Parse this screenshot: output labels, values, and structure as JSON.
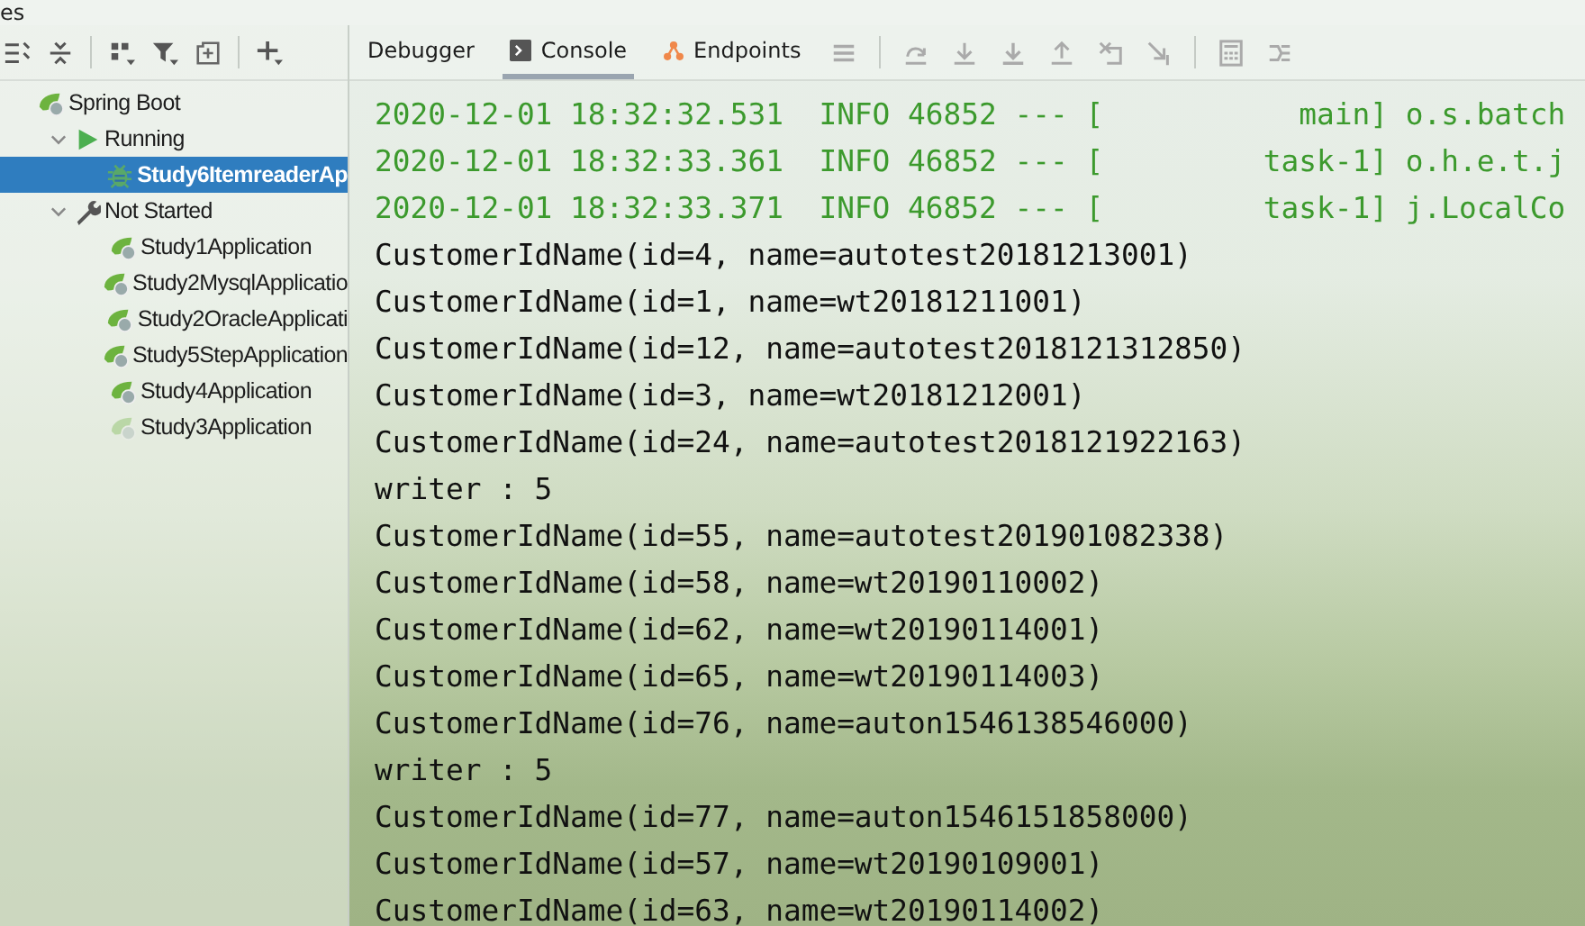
{
  "window": {
    "title": "es"
  },
  "tree": [
    {
      "label": "Spring Boot",
      "kind": "app",
      "selected": false,
      "children": [
        {
          "label": "Running",
          "kind": "run",
          "expanded": true,
          "selected": false,
          "children": [
            {
              "label": "Study6ItemreaderAp",
              "kind": "bug",
              "selected": true
            }
          ]
        },
        {
          "label": "Not Started",
          "kind": "wrench",
          "expanded": true,
          "selected": false,
          "children": [
            {
              "label": "Study1Application",
              "kind": "app",
              "selected": false
            },
            {
              "label": "Study2MysqlApplicatio",
              "kind": "app",
              "selected": false
            },
            {
              "label": "Study2OracleApplicati",
              "kind": "app",
              "selected": false
            },
            {
              "label": "Study5StepApplication",
              "kind": "app",
              "selected": false
            },
            {
              "label": "Study4Application",
              "kind": "app",
              "selected": false
            },
            {
              "label": "Study3Application",
              "kind": "idle",
              "selected": false
            }
          ]
        }
      ]
    }
  ],
  "tabs": [
    {
      "label": "Debugger",
      "kind": "plain",
      "selected": false
    },
    {
      "label": "Console",
      "kind": "console",
      "selected": true
    },
    {
      "label": "Endpoints",
      "kind": "endpoints",
      "selected": false
    }
  ],
  "console": [
    {
      "kind": "info",
      "text": "2020-12-01 18:32:32.531  INFO 46852 --- [           main] o.s.batch"
    },
    {
      "kind": "info",
      "text": "2020-12-01 18:32:33.361  INFO 46852 --- [         task-1] o.h.e.t.j"
    },
    {
      "kind": "info",
      "text": "2020-12-01 18:32:33.371  INFO 46852 --- [         task-1] j.LocalCo"
    },
    {
      "kind": "out",
      "text": "CustomerIdName(id=4, name=autotest20181213001)"
    },
    {
      "kind": "out",
      "text": "CustomerIdName(id=1, name=wt20181211001)"
    },
    {
      "kind": "out",
      "text": "CustomerIdName(id=12, name=autotest2018121312850)"
    },
    {
      "kind": "out",
      "text": "CustomerIdName(id=3, name=wt20181212001)"
    },
    {
      "kind": "out",
      "text": "CustomerIdName(id=24, name=autotest2018121922163)"
    },
    {
      "kind": "out",
      "text": "writer : 5"
    },
    {
      "kind": "out",
      "text": "CustomerIdName(id=55, name=autotest201901082338)"
    },
    {
      "kind": "out",
      "text": "CustomerIdName(id=58, name=wt20190110002)"
    },
    {
      "kind": "out",
      "text": "CustomerIdName(id=62, name=wt20190114001)"
    },
    {
      "kind": "out",
      "text": "CustomerIdName(id=65, name=wt20190114003)"
    },
    {
      "kind": "out",
      "text": "CustomerIdName(id=76, name=auton1546138546000)"
    },
    {
      "kind": "out",
      "text": "writer : 5"
    },
    {
      "kind": "out",
      "text": "CustomerIdName(id=77, name=auton1546151858000)"
    },
    {
      "kind": "out",
      "text": "CustomerIdName(id=57, name=wt20190109001)"
    },
    {
      "kind": "out",
      "text": "CustomerIdName(id=63, name=wt20190114002)"
    }
  ]
}
